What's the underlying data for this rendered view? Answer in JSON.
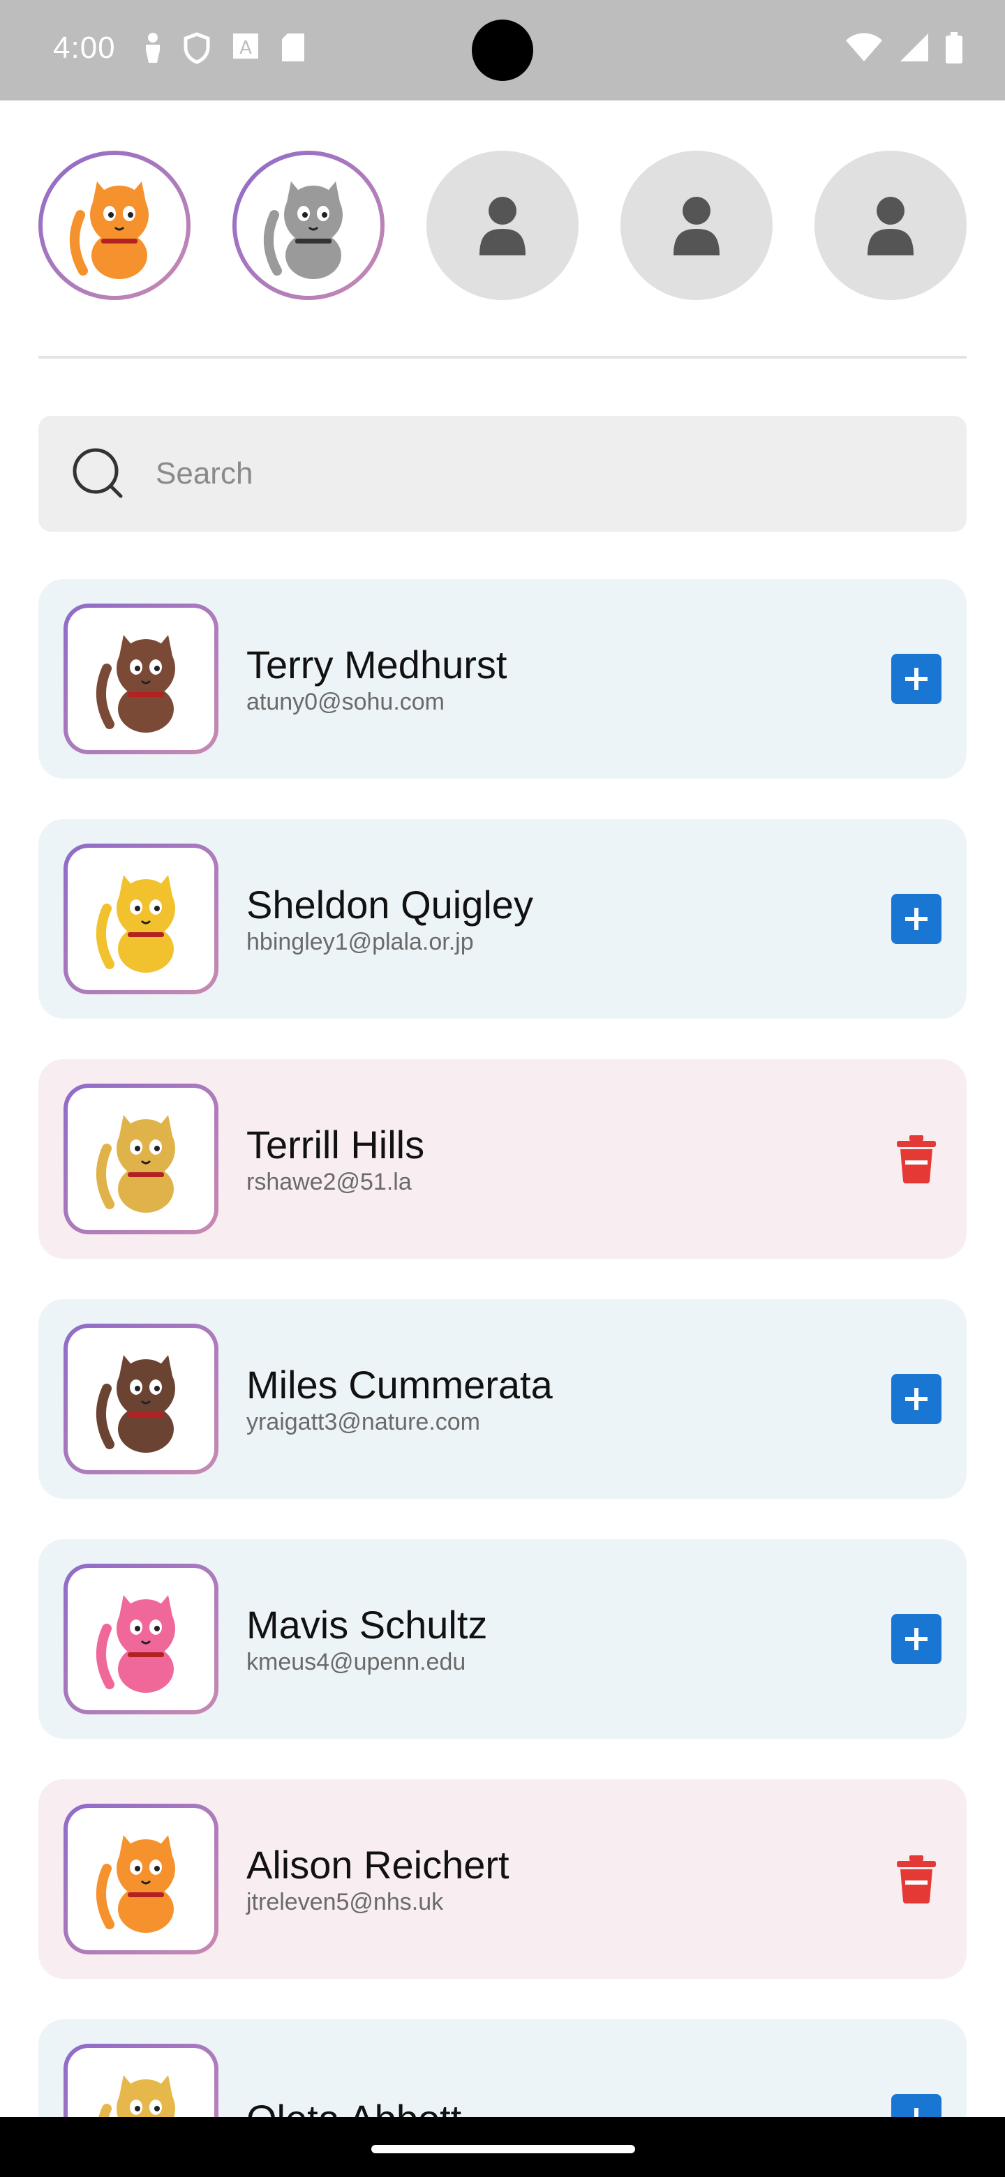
{
  "status_bar": {
    "time": "4:00",
    "left_icons": [
      "person-icon",
      "shield-icon",
      "a-badge-icon",
      "sd-card-icon"
    ],
    "right_icons": [
      "wifi-icon",
      "signal-icon",
      "battery-icon"
    ]
  },
  "selected_avatars": [
    {
      "type": "cat",
      "color": "#f5922e",
      "accent": "#b22222"
    },
    {
      "type": "cat",
      "color": "#9a9a9a",
      "accent": "#333333"
    },
    {
      "type": "placeholder"
    },
    {
      "type": "placeholder"
    },
    {
      "type": "placeholder"
    }
  ],
  "search": {
    "placeholder": "Search"
  },
  "users": [
    {
      "name": "Terry Medhurst",
      "email": "atuny0@sohu.com",
      "action": "add",
      "cat_color": "#7b4a36",
      "card": "blue"
    },
    {
      "name": "Sheldon Quigley",
      "email": "hbingley1@plala.or.jp",
      "action": "add",
      "cat_color": "#f2c12e",
      "card": "blue"
    },
    {
      "name": "Terrill Hills",
      "email": "rshawe2@51.la",
      "action": "remove",
      "cat_color": "#e0b24a",
      "card": "pink"
    },
    {
      "name": "Miles Cummerata",
      "email": "yraigatt3@nature.com",
      "action": "add",
      "cat_color": "#6b4332",
      "card": "blue"
    },
    {
      "name": "Mavis Schultz",
      "email": "kmeus4@upenn.edu",
      "action": "add",
      "cat_color": "#f0679a",
      "card": "blue"
    },
    {
      "name": "Alison Reichert",
      "email": "jtreleven5@nhs.uk",
      "action": "remove",
      "cat_color": "#f5922e",
      "card": "pink"
    },
    {
      "name": "Oleta Abbott",
      "email": "",
      "action": "add",
      "cat_color": "#e6b84c",
      "card": "blue"
    }
  ],
  "colors": {
    "add_button": "#1976d2",
    "remove_button": "#e53935",
    "avatar_border_start": "#8e6ac9",
    "avatar_border_end": "#c88ab1"
  }
}
